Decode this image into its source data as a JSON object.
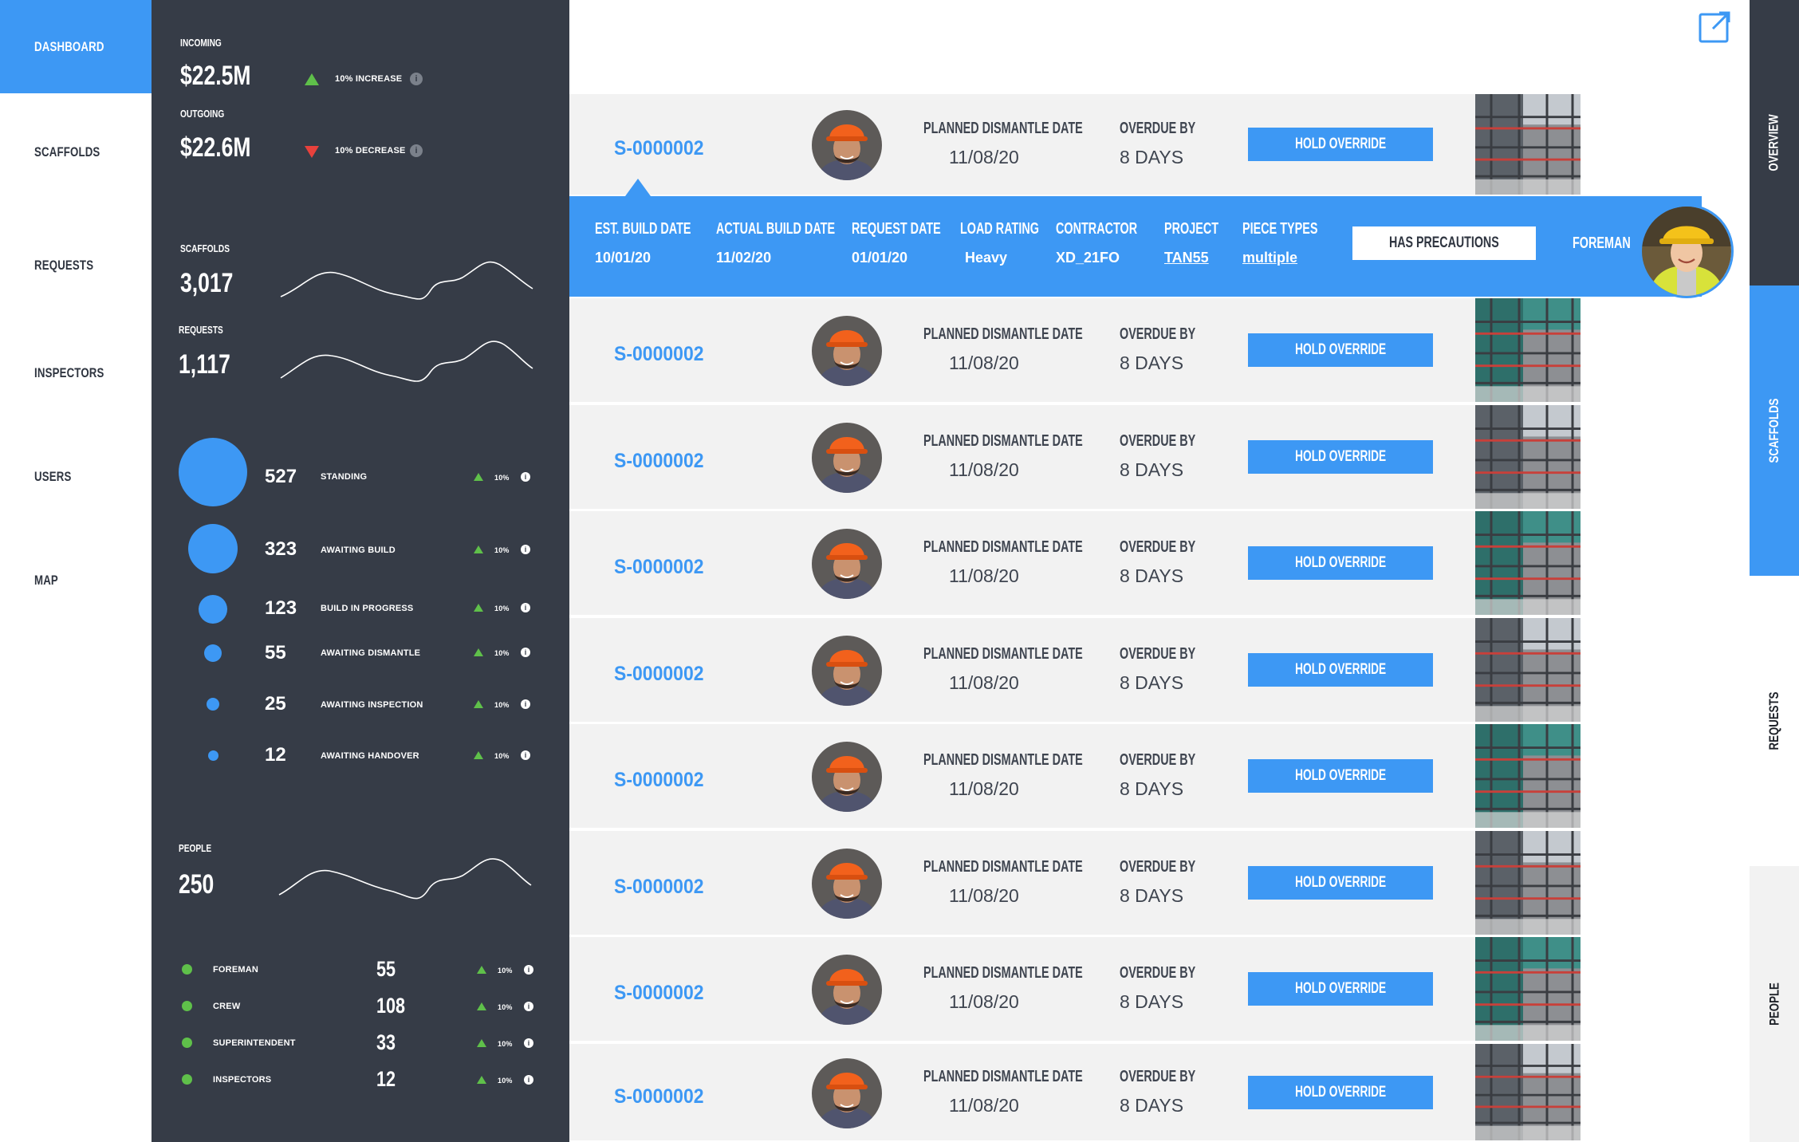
{
  "nav": {
    "items": [
      {
        "label": "DASHBOARD",
        "active": true
      },
      {
        "label": "SCAFFOLDS",
        "active": false
      },
      {
        "label": "REQUESTS",
        "active": false
      },
      {
        "label": "INSPECTORS",
        "active": false
      },
      {
        "label": "USERS",
        "active": false
      },
      {
        "label": "MAP",
        "active": false
      }
    ]
  },
  "stats": {
    "incoming": {
      "label": "INCOMING",
      "value": "$22.5M",
      "change": "10% INCREASE"
    },
    "outgoing": {
      "label": "OUTGOING",
      "value": "$22.6M",
      "change": "10% DECREASE"
    },
    "scaffolds": {
      "label": "SCAFFOLDS",
      "value": "3,017"
    },
    "requests": {
      "label": "REQUESTS",
      "value": "1,117"
    },
    "statuses": [
      {
        "count": "527",
        "label": "STANDING",
        "change": "10%"
      },
      {
        "count": "323",
        "label": "AWAITING BUILD",
        "change": "10%"
      },
      {
        "count": "123",
        "label": "BUILD IN PROGRESS",
        "change": "10%"
      },
      {
        "count": "55",
        "label": "AWAITING DISMANTLE",
        "change": "10%"
      },
      {
        "count": "25",
        "label": "AWAITING INSPECTION",
        "change": "10%"
      },
      {
        "count": "12",
        "label": "AWAITING HANDOVER",
        "change": "10%"
      }
    ],
    "people": {
      "label": "PEOPLE",
      "value": "250"
    },
    "roles": [
      {
        "label": "FOREMAN",
        "count": "55",
        "change": "10%"
      },
      {
        "label": "CREW",
        "count": "108",
        "change": "10%"
      },
      {
        "label": "SUPERINTENDENT",
        "count": "33",
        "change": "10%"
      },
      {
        "label": "INSPECTORS",
        "count": "12",
        "change": "10%"
      }
    ]
  },
  "list": {
    "rows": [
      {
        "id": "S-0000002",
        "dismantle_label": "PLANNED DISMANTLE DATE",
        "dismantle_date": "11/08/20",
        "overdue_label": "OVERDUE BY",
        "overdue_value": "8 DAYS",
        "action": "HOLD OVERRIDE"
      },
      {
        "id": "S-0000002",
        "dismantle_label": "PLANNED DISMANTLE DATE",
        "dismantle_date": "11/08/20",
        "overdue_label": "OVERDUE BY",
        "overdue_value": "8 DAYS",
        "action": "HOLD OVERRIDE"
      },
      {
        "id": "S-0000002",
        "dismantle_label": "PLANNED DISMANTLE DATE",
        "dismantle_date": "11/08/20",
        "overdue_label": "OVERDUE BY",
        "overdue_value": "8 DAYS",
        "action": "HOLD OVERRIDE"
      },
      {
        "id": "S-0000002",
        "dismantle_label": "PLANNED DISMANTLE DATE",
        "dismantle_date": "11/08/20",
        "overdue_label": "OVERDUE BY",
        "overdue_value": "8 DAYS",
        "action": "HOLD OVERRIDE"
      },
      {
        "id": "S-0000002",
        "dismantle_label": "PLANNED DISMANTLE DATE",
        "dismantle_date": "11/08/20",
        "overdue_label": "OVERDUE BY",
        "overdue_value": "8 DAYS",
        "action": "HOLD OVERRIDE"
      },
      {
        "id": "S-0000002",
        "dismantle_label": "PLANNED DISMANTLE DATE",
        "dismantle_date": "11/08/20",
        "overdue_label": "OVERDUE BY",
        "overdue_value": "8 DAYS",
        "action": "HOLD OVERRIDE"
      },
      {
        "id": "S-0000002",
        "dismantle_label": "PLANNED DISMANTLE DATE",
        "dismantle_date": "11/08/20",
        "overdue_label": "OVERDUE BY",
        "overdue_value": "8 DAYS",
        "action": "HOLD OVERRIDE"
      },
      {
        "id": "S-0000002",
        "dismantle_label": "PLANNED DISMANTLE DATE",
        "dismantle_date": "11/08/20",
        "overdue_label": "OVERDUE BY",
        "overdue_value": "8 DAYS",
        "action": "HOLD OVERRIDE"
      },
      {
        "id": "S-0000002",
        "dismantle_label": "PLANNED DISMANTLE DATE",
        "dismantle_date": "11/08/20",
        "overdue_label": "OVERDUE BY",
        "overdue_value": "8 DAYS",
        "action": "HOLD OVERRIDE"
      }
    ]
  },
  "details": {
    "columns": [
      {
        "label": "EST. BUILD DATE",
        "value": "10/01/20",
        "link": false
      },
      {
        "label": "ACTUAL BUILD DATE",
        "value": "11/02/20",
        "link": false
      },
      {
        "label": "REQUEST DATE",
        "value": "01/01/20",
        "link": false
      },
      {
        "label": "LOAD RATING",
        "value": "Heavy",
        "link": false
      },
      {
        "label": "CONTRACTOR",
        "value": "XD_21FO",
        "link": false
      },
      {
        "label": "PROJECT",
        "value": "TAN55",
        "link": true
      },
      {
        "label": "PIECE TYPES",
        "value": "multiple",
        "link": true
      }
    ],
    "precautions": "HAS PRECAUTIONS",
    "foreman": "FOREMAN"
  },
  "tabs": [
    {
      "label": "OVERVIEW",
      "active": false
    },
    {
      "label": "SCAFFOLDS",
      "active": true
    },
    {
      "label": "REQUESTS",
      "active": false
    },
    {
      "label": "PEOPLE",
      "active": false
    }
  ],
  "colors": {
    "accent": "#3d98f4",
    "panel": "#363c47",
    "up": "#5fc04a",
    "down": "#e8413c"
  },
  "icons": {
    "popout": "external-link-icon",
    "info": "info-icon"
  }
}
